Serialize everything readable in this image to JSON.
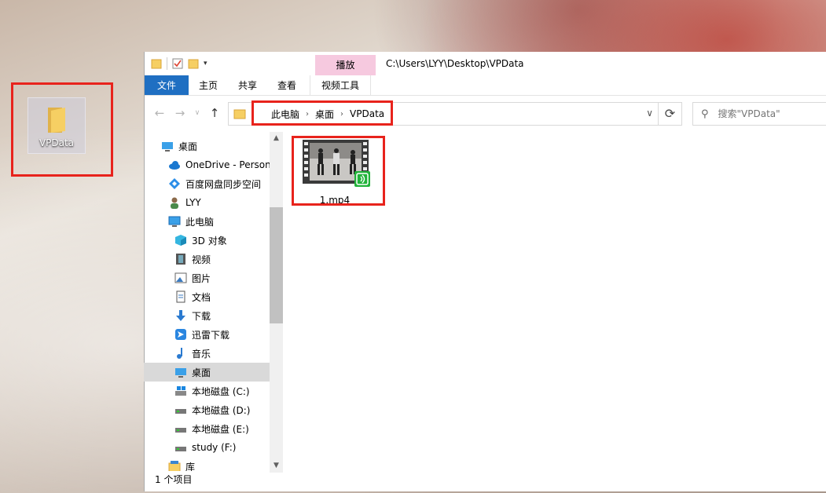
{
  "desktop": {
    "folder_label": "VPData"
  },
  "window": {
    "title_path": "C:\\Users\\LYY\\Desktop\\VPData",
    "context_tab": "播放",
    "ribbon_tabs": {
      "file": "文件",
      "home": "主页",
      "share": "共享",
      "view": "查看",
      "video_tools": "视频工具"
    },
    "address": {
      "crumb_pc": "此电脑",
      "crumb_desktop": "桌面",
      "crumb_folder": "VPData"
    },
    "search_placeholder": "搜索\"VPData\"",
    "nav": {
      "desktop_top": "桌面",
      "onedrive": "OneDrive - Person",
      "baidu": "百度网盘同步空间",
      "user": "LYY",
      "this_pc": "此电脑",
      "objects3d": "3D 对象",
      "videos": "视频",
      "pictures": "图片",
      "documents": "文档",
      "downloads": "下载",
      "xunlei": "迅雷下载",
      "music": "音乐",
      "desktop": "桌面",
      "disk_c": "本地磁盘 (C:)",
      "disk_d": "本地磁盘 (D:)",
      "disk_e": "本地磁盘 (E:)",
      "disk_f": "study (F:)",
      "library": "库"
    },
    "files": [
      {
        "name": "1.mp4"
      }
    ],
    "status": "1 个项目"
  },
  "colors": {
    "file_tab": "#1f6fc2",
    "context_tab": "#f6c9df",
    "highlight": "#e8231c",
    "selected": "#d9d9d9"
  }
}
